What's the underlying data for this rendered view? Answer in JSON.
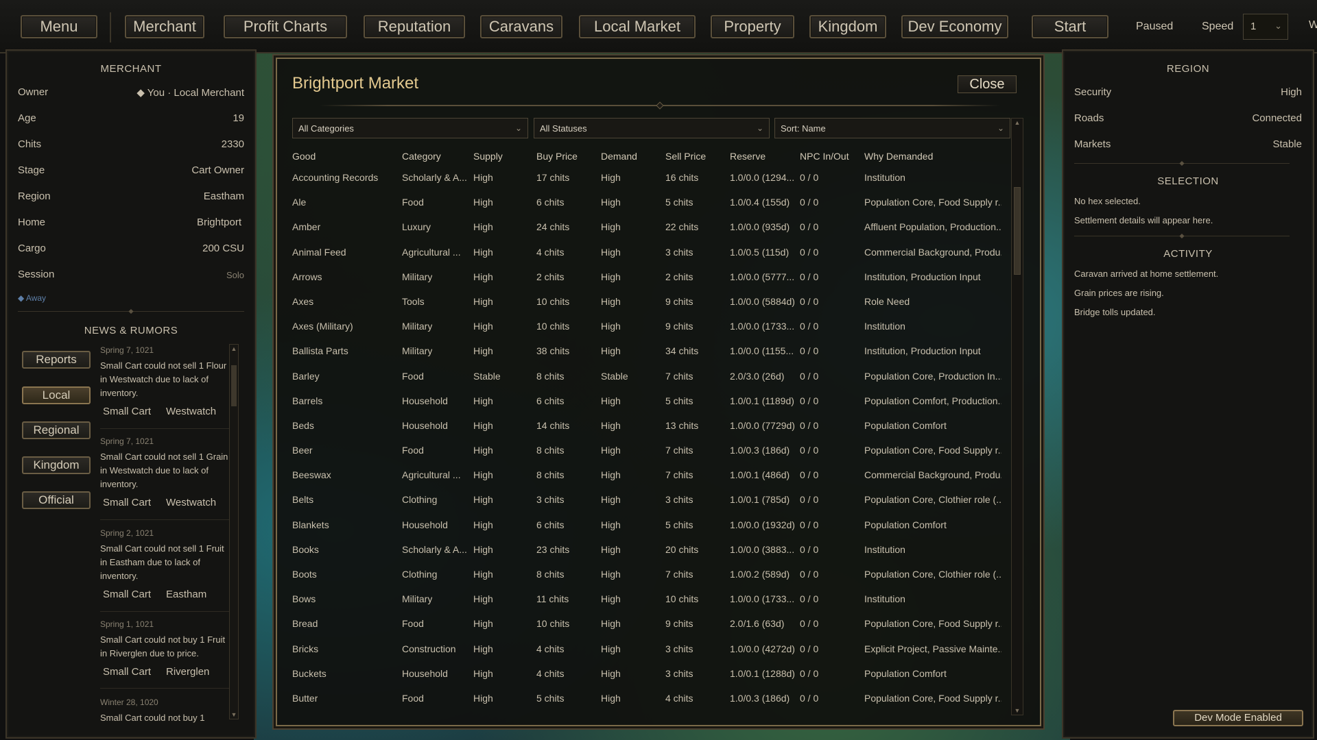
{
  "nav": {
    "menu": "Menu",
    "merchant": "Merchant",
    "profit_charts": "Profit Charts",
    "reputation": "Reputation",
    "caravans": "Caravans",
    "local_market": "Local Market",
    "property": "Property",
    "kingdom": "Kingdom",
    "dev_economy": "Dev Economy",
    "start": "Start",
    "paused": "Paused",
    "speed_label": "Speed",
    "speed_value": "1",
    "edge_text": "W"
  },
  "merchant": {
    "title": "MERCHANT",
    "fields": [
      {
        "label": "Owner",
        "value": "◆ You · Local Merchant"
      },
      {
        "label": "Age",
        "value": "19"
      },
      {
        "label": "Chits",
        "value": "2330"
      },
      {
        "label": "Stage",
        "value": "Cart Owner"
      },
      {
        "label": "Region",
        "value": "Eastham"
      },
      {
        "label": "Home",
        "value": "Brightport"
      },
      {
        "label": "Cargo",
        "value": "200 CSU"
      },
      {
        "label": "Session",
        "value": "Solo"
      }
    ],
    "away": "◆ Away"
  },
  "news": {
    "title": "NEWS & RUMORS",
    "filters": [
      "Reports",
      "Local",
      "Regional",
      "Kingdom",
      "Official"
    ],
    "active_filter": "Local",
    "items": [
      {
        "date": "Spring 7, 1021",
        "text": "Small Cart could not sell 1 Flour in Westwatch due to lack of inventory.",
        "tags": [
          "Small Cart",
          "Westwatch"
        ]
      },
      {
        "date": "Spring 7, 1021",
        "text": "Small Cart could not sell 1 Grain in Westwatch due to lack of inventory.",
        "tags": [
          "Small Cart",
          "Westwatch"
        ]
      },
      {
        "date": "Spring 2, 1021",
        "text": "Small Cart could not sell 1 Fruit in Eastham due to lack of inventory.",
        "tags": [
          "Small Cart",
          "Eastham"
        ]
      },
      {
        "date": "Spring 1, 1021",
        "text": "Small Cart could not buy 1 Fruit in Riverglen due to price.",
        "tags": [
          "Small Cart",
          "Riverglen"
        ]
      },
      {
        "date": "Winter 28, 1020",
        "text": "Small Cart could not buy 1",
        "tags": []
      }
    ]
  },
  "region": {
    "title": "REGION",
    "fields": [
      {
        "label": "Security",
        "value": "High"
      },
      {
        "label": "Roads",
        "value": "Connected"
      },
      {
        "label": "Markets",
        "value": "Stable"
      }
    ],
    "selection_title": "SELECTION",
    "selection_lines": [
      "No hex selected.",
      "Settlement details will appear here."
    ],
    "activity_title": "ACTIVITY",
    "activity_lines": [
      "Caravan arrived at home settlement.",
      "Grain prices are rising.",
      "Bridge tolls updated."
    ],
    "dev_mode": "Dev Mode Enabled"
  },
  "market": {
    "title": "Brightport Market",
    "close": "Close",
    "filters": {
      "category": "All Categories",
      "status": "All Statuses",
      "sort": "Sort: Name"
    },
    "columns": [
      "Good",
      "Category",
      "Supply",
      "Buy Price",
      "Demand",
      "Sell Price",
      "Reserve",
      "NPC In/Out",
      "Why Demanded"
    ],
    "rows": [
      [
        "Accounting Records",
        "Scholarly & A...",
        "High",
        "17 chits",
        "High",
        "16 chits",
        "1.0/0.0 (1294...",
        "0 / 0",
        "Institution"
      ],
      [
        "Ale",
        "Food",
        "High",
        "6 chits",
        "High",
        "5 chits",
        "1.0/0.4 (155d)",
        "0 / 0",
        "Population Core, Food Supply r..."
      ],
      [
        "Amber",
        "Luxury",
        "High",
        "24 chits",
        "High",
        "22 chits",
        "1.0/0.0 (935d)",
        "0 / 0",
        "Affluent Population, Production..."
      ],
      [
        "Animal Feed",
        "Agricultural ...",
        "High",
        "4 chits",
        "High",
        "3 chits",
        "1.0/0.5 (115d)",
        "0 / 0",
        "Commercial Background, Produ..."
      ],
      [
        "Arrows",
        "Military",
        "High",
        "2 chits",
        "High",
        "2 chits",
        "1.0/0.0 (5777...",
        "0 / 0",
        "Institution, Production Input"
      ],
      [
        "Axes",
        "Tools",
        "High",
        "10 chits",
        "High",
        "9 chits",
        "1.0/0.0 (5884d)",
        "0 / 0",
        "Role Need"
      ],
      [
        "Axes (Military)",
        "Military",
        "High",
        "10 chits",
        "High",
        "9 chits",
        "1.0/0.0 (1733...",
        "0 / 0",
        "Institution"
      ],
      [
        "Ballista Parts",
        "Military",
        "High",
        "38 chits",
        "High",
        "34 chits",
        "1.0/0.0 (1155...",
        "0 / 0",
        "Institution, Production Input"
      ],
      [
        "Barley",
        "Food",
        "Stable",
        "8 chits",
        "Stable",
        "7 chits",
        "2.0/3.0 (26d)",
        "0 / 0",
        "Population Core, Production In..."
      ],
      [
        "Barrels",
        "Household",
        "High",
        "6 chits",
        "High",
        "5 chits",
        "1.0/0.1 (1189d)",
        "0 / 0",
        "Population Comfort, Production..."
      ],
      [
        "Beds",
        "Household",
        "High",
        "14 chits",
        "High",
        "13 chits",
        "1.0/0.0 (7729d)",
        "0 / 0",
        "Population Comfort"
      ],
      [
        "Beer",
        "Food",
        "High",
        "8 chits",
        "High",
        "7 chits",
        "1.0/0.3 (186d)",
        "0 / 0",
        "Population Core, Food Supply r..."
      ],
      [
        "Beeswax",
        "Agricultural ...",
        "High",
        "8 chits",
        "High",
        "7 chits",
        "1.0/0.1 (486d)",
        "0 / 0",
        "Commercial Background, Produ..."
      ],
      [
        "Belts",
        "Clothing",
        "High",
        "3 chits",
        "High",
        "3 chits",
        "1.0/0.1 (785d)",
        "0 / 0",
        "Population Core, Clothier role (..."
      ],
      [
        "Blankets",
        "Household",
        "High",
        "6 chits",
        "High",
        "5 chits",
        "1.0/0.0 (1932d)",
        "0 / 0",
        "Population Comfort"
      ],
      [
        "Books",
        "Scholarly & A...",
        "High",
        "23 chits",
        "High",
        "20 chits",
        "1.0/0.0 (3883...",
        "0 / 0",
        "Institution"
      ],
      [
        "Boots",
        "Clothing",
        "High",
        "8 chits",
        "High",
        "7 chits",
        "1.0/0.2 (589d)",
        "0 / 0",
        "Population Core, Clothier role (..."
      ],
      [
        "Bows",
        "Military",
        "High",
        "11 chits",
        "High",
        "10 chits",
        "1.0/0.0 (1733...",
        "0 / 0",
        "Institution"
      ],
      [
        "Bread",
        "Food",
        "High",
        "10 chits",
        "High",
        "9 chits",
        "2.0/1.6 (63d)",
        "0 / 0",
        "Population Core, Food Supply r..."
      ],
      [
        "Bricks",
        "Construction",
        "High",
        "4 chits",
        "High",
        "3 chits",
        "1.0/0.0 (4272d)",
        "0 / 0",
        "Explicit Project, Passive Mainte..."
      ],
      [
        "Buckets",
        "Household",
        "High",
        "4 chits",
        "High",
        "3 chits",
        "1.0/0.1 (1288d)",
        "0 / 0",
        "Population Comfort"
      ],
      [
        "Butter",
        "Food",
        "High",
        "5 chits",
        "High",
        "4 chits",
        "1.0/0.3 (186d)",
        "0 / 0",
        "Population Core, Food Supply r..."
      ]
    ]
  }
}
